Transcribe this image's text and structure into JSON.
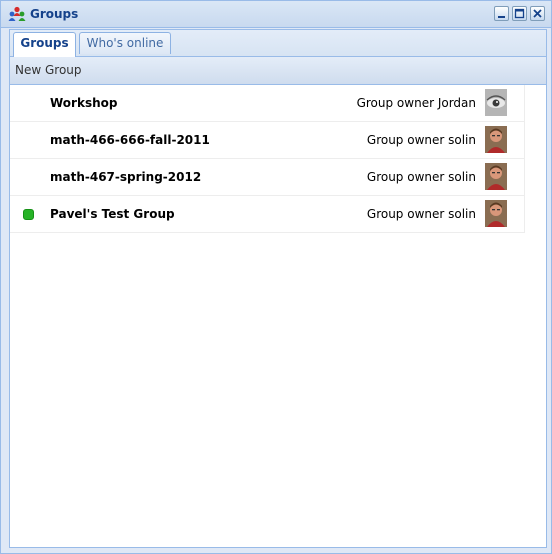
{
  "window": {
    "title": "Groups",
    "title_icon": "groups-people-icon",
    "tools": [
      "minimize-icon",
      "maximize-icon",
      "close-icon"
    ]
  },
  "tabs": [
    {
      "label": "Groups",
      "active": true
    },
    {
      "label": "Who's online",
      "active": false
    }
  ],
  "toolbar": {
    "new_group_label": "New Group"
  },
  "groups": [
    {
      "name": "Workshop",
      "owner_text": "Group owner Jordan",
      "avatar": "eye-avatar",
      "online": false
    },
    {
      "name": "math-466-666-fall-2011",
      "owner_text": "Group owner solin",
      "avatar": "man-avatar",
      "online": false
    },
    {
      "name": "math-467-spring-2012",
      "owner_text": "Group owner solin",
      "avatar": "man-avatar",
      "online": false
    },
    {
      "name": "Pavel's Test Group",
      "owner_text": "Group owner solin",
      "avatar": "man-avatar",
      "online": true
    }
  ],
  "colors": {
    "online": "#27b327",
    "title_text": "#15428b",
    "border": "#99bbe8"
  }
}
